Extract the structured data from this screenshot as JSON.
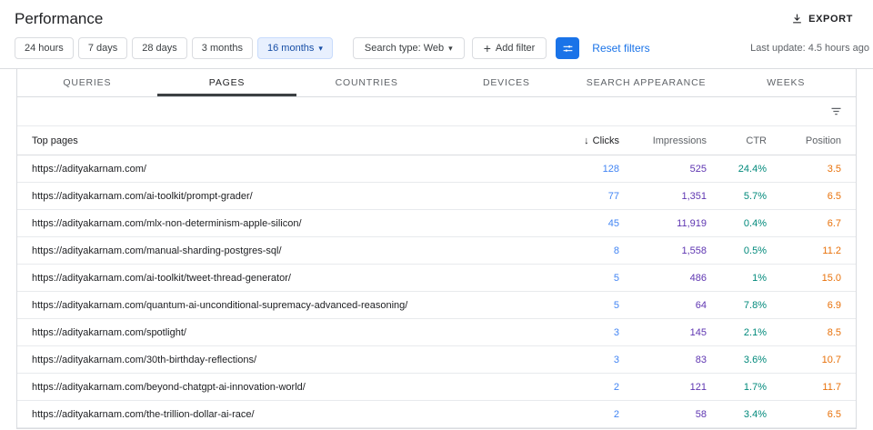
{
  "header": {
    "title": "Performance",
    "export_label": "EXPORT"
  },
  "filters": {
    "date_ranges": [
      {
        "label": "24 hours",
        "selected": false
      },
      {
        "label": "7 days",
        "selected": false
      },
      {
        "label": "28 days",
        "selected": false
      },
      {
        "label": "3 months",
        "selected": false
      },
      {
        "label": "16 months",
        "selected": true
      }
    ],
    "search_type_label": "Search type: Web",
    "add_filter_label": "Add filter",
    "reset_filters_label": "Reset filters",
    "last_update": "Last update: 4.5 hours ago"
  },
  "tabs": [
    {
      "label": "QUERIES",
      "active": false
    },
    {
      "label": "PAGES",
      "active": true
    },
    {
      "label": "COUNTRIES",
      "active": false
    },
    {
      "label": "DEVICES",
      "active": false
    },
    {
      "label": "SEARCH APPEARANCE",
      "active": false
    },
    {
      "label": "WEEKS",
      "active": false
    }
  ],
  "icons": {
    "caret_down": "▾",
    "plus": "+",
    "arrow_down": "↓"
  },
  "table": {
    "columns": [
      "Top pages",
      "Clicks",
      "Impressions",
      "CTR",
      "Position"
    ],
    "sorted_by": "Clicks",
    "sort_direction": "desc",
    "rows": [
      {
        "page": "https://adityakarnam.com/",
        "clicks": "128",
        "impressions": "525",
        "ctr": "24.4%",
        "position": "3.5"
      },
      {
        "page": "https://adityakarnam.com/ai-toolkit/prompt-grader/",
        "clicks": "77",
        "impressions": "1,351",
        "ctr": "5.7%",
        "position": "6.5"
      },
      {
        "page": "https://adityakarnam.com/mlx-non-determinism-apple-silicon/",
        "clicks": "45",
        "impressions": "11,919",
        "ctr": "0.4%",
        "position": "6.7"
      },
      {
        "page": "https://adityakarnam.com/manual-sharding-postgres-sql/",
        "clicks": "8",
        "impressions": "1,558",
        "ctr": "0.5%",
        "position": "11.2"
      },
      {
        "page": "https://adityakarnam.com/ai-toolkit/tweet-thread-generator/",
        "clicks": "5",
        "impressions": "486",
        "ctr": "1%",
        "position": "15.0"
      },
      {
        "page": "https://adityakarnam.com/quantum-ai-unconditional-supremacy-advanced-reasoning/",
        "clicks": "5",
        "impressions": "64",
        "ctr": "7.8%",
        "position": "6.9"
      },
      {
        "page": "https://adityakarnam.com/spotlight/",
        "clicks": "3",
        "impressions": "145",
        "ctr": "2.1%",
        "position": "8.5"
      },
      {
        "page": "https://adityakarnam.com/30th-birthday-reflections/",
        "clicks": "3",
        "impressions": "83",
        "ctr": "3.6%",
        "position": "10.7"
      },
      {
        "page": "https://adityakarnam.com/beyond-chatgpt-ai-innovation-world/",
        "clicks": "2",
        "impressions": "121",
        "ctr": "1.7%",
        "position": "11.7"
      },
      {
        "page": "https://adityakarnam.com/the-trillion-dollar-ai-race/",
        "clicks": "2",
        "impressions": "58",
        "ctr": "3.4%",
        "position": "6.5"
      }
    ]
  },
  "colors": {
    "clicks": "#4285f4",
    "impressions": "#5e35b1",
    "ctr": "#00897b",
    "position": "#e8710a",
    "accent": "#1a73e8"
  }
}
